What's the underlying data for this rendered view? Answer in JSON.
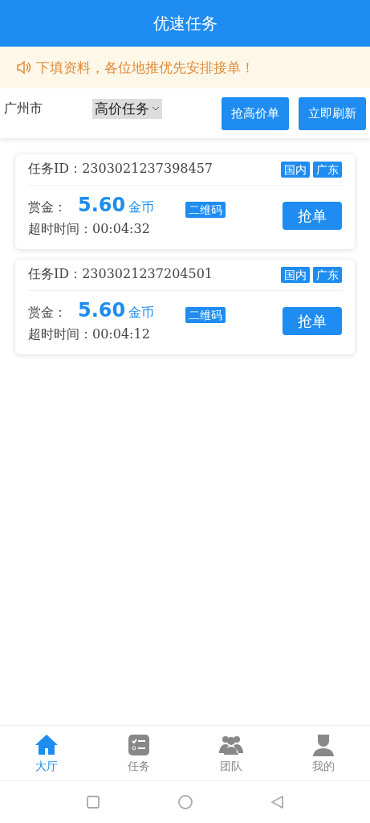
{
  "header": {
    "title": "优速任务"
  },
  "notice": {
    "text": "下填资料，各位地推优先安排接单！"
  },
  "filter": {
    "city": "广州市",
    "category": "高价任务",
    "buttons": [
      "抢高价单",
      "立即刷新"
    ]
  },
  "tasks": [
    {
      "id_label": "任务ID：",
      "id": "2303021237398457",
      "tags": [
        "国内",
        "广东"
      ],
      "reward_label": "赏金：",
      "reward": "5.60",
      "unit": "金币",
      "type_tag": "二维码",
      "timeout_label": "超时时间：",
      "timeout": "00:04:32",
      "action": "抢单"
    },
    {
      "id_label": "任务ID：",
      "id": "2303021237204501",
      "tags": [
        "国内",
        "广东"
      ],
      "reward_label": "赏金：",
      "reward": "5.60",
      "unit": "金币",
      "type_tag": "二维码",
      "timeout_label": "超时时间：",
      "timeout": "00:04:12",
      "action": "抢单"
    }
  ],
  "tabbar": [
    {
      "kind": "home",
      "label": "大厅",
      "selected": true
    },
    {
      "kind": "tasks",
      "label": "任务",
      "selected": false
    },
    {
      "kind": "team",
      "label": "团队",
      "selected": false
    },
    {
      "kind": "me",
      "label": "我的",
      "selected": false
    }
  ]
}
